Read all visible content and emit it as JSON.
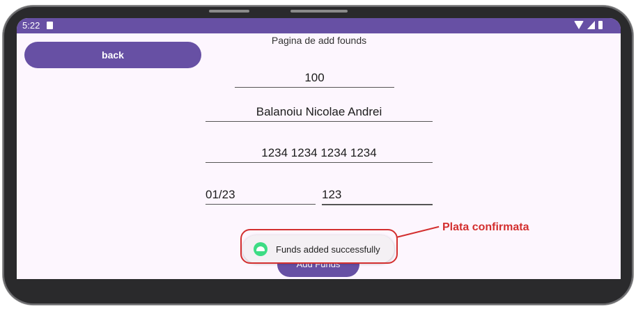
{
  "status_bar": {
    "time": "5:22",
    "icons": [
      "sd-card-icon",
      "wifi-icon",
      "signal-icon",
      "battery-icon"
    ]
  },
  "page": {
    "title": "Pagina de add founds",
    "back_label": "back"
  },
  "form": {
    "amount": "100",
    "cardholder_name": "Balanoiu Nicolae Andrei",
    "card_number": "1234 1234 1234 1234",
    "expiry": "01/23",
    "cvv": "123"
  },
  "submit": {
    "label": "Add Funds"
  },
  "toast": {
    "message": "Funds added successfully",
    "icon": "android-icon"
  },
  "annotation": {
    "label": "Plata confirmata",
    "color": "#d32f2f"
  },
  "colors": {
    "accent": "#6750a4",
    "background": "#fdf6fe"
  }
}
